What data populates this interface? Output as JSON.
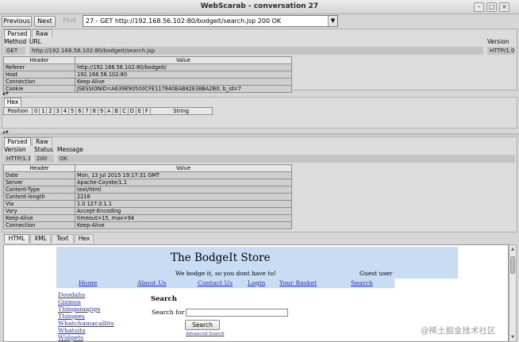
{
  "window": {
    "title": "WebScarab - conversation 27",
    "controls": [
      "–",
      "□",
      "×"
    ]
  },
  "nav": {
    "previous": "Previous",
    "next": "Next",
    "find": "Find",
    "conversation": "27 - GET http://192.168.56.102:80/bodgeit/search.jsp    200 OK"
  },
  "request": {
    "tabs": [
      "Parsed",
      "Raw"
    ],
    "method_label": "Method",
    "url_label": "URL",
    "version_label": "Version",
    "method": "GET",
    "url": "http://192.168.56.102:80/bodgeit/search.jsp",
    "version": "HTTP/1.0",
    "headers_col": [
      "Header",
      "Value"
    ],
    "headers": [
      [
        "Referer",
        "http://192.168.56.102:80/bodgeit/"
      ],
      [
        "Host",
        "192.168.56.102:80"
      ],
      [
        "Connection",
        "Keep-Alive"
      ],
      [
        "Cookie",
        "JSESSIONID=A639E90500CFE117840EAB82E38BA2B0; b_id=7"
      ]
    ]
  },
  "hex": {
    "tab": "Hex",
    "cols": [
      "Position",
      "0",
      "1",
      "2",
      "3",
      "4",
      "5",
      "6",
      "7",
      "8",
      "9",
      "A",
      "B",
      "C",
      "D",
      "E",
      "F",
      "String"
    ]
  },
  "response": {
    "tabs": [
      "Parsed",
      "Raw"
    ],
    "version_label": "Version",
    "status_label": "Status",
    "message_label": "Message",
    "version": "HTTP/1.1",
    "status": "200",
    "message": "OK",
    "headers_col": [
      "Header",
      "Value"
    ],
    "headers": [
      [
        "Date",
        "Mon, 13 Jul 2015 19:17:31 GMT"
      ],
      [
        "Server",
        "Apache-Coyote/1.1"
      ],
      [
        "Content-Type",
        "text/html"
      ],
      [
        "Content-length",
        "2216"
      ],
      [
        "Via",
        "1.0 127.0.1.1"
      ],
      [
        "Vary",
        "Accept-Encoding"
      ],
      [
        "Keep-Alive",
        "timeout=15, max=94"
      ],
      [
        "Connection",
        "Keep-Alive"
      ]
    ]
  },
  "content_tabs": [
    "HTML",
    "XML",
    "Text",
    "Hex"
  ],
  "store": {
    "title": "The BodgeIt Store",
    "motto": "We bodge it, so you dont have to!",
    "user": "Guest user",
    "nav": [
      "Home",
      "About Us",
      "Contact Us",
      "Login",
      "Your Basket",
      "Search"
    ],
    "sidebar": [
      "Doodahs",
      "Gizmos",
      "Thingamajigs",
      "Thingies",
      "Whatchamacallits",
      "Whatsits",
      "Widgets"
    ],
    "search_heading": "Search",
    "search_for": "Search for",
    "search_button": "Search",
    "advanced": "Advanced Search"
  },
  "watermark": "@稀土掘金技术社区"
}
